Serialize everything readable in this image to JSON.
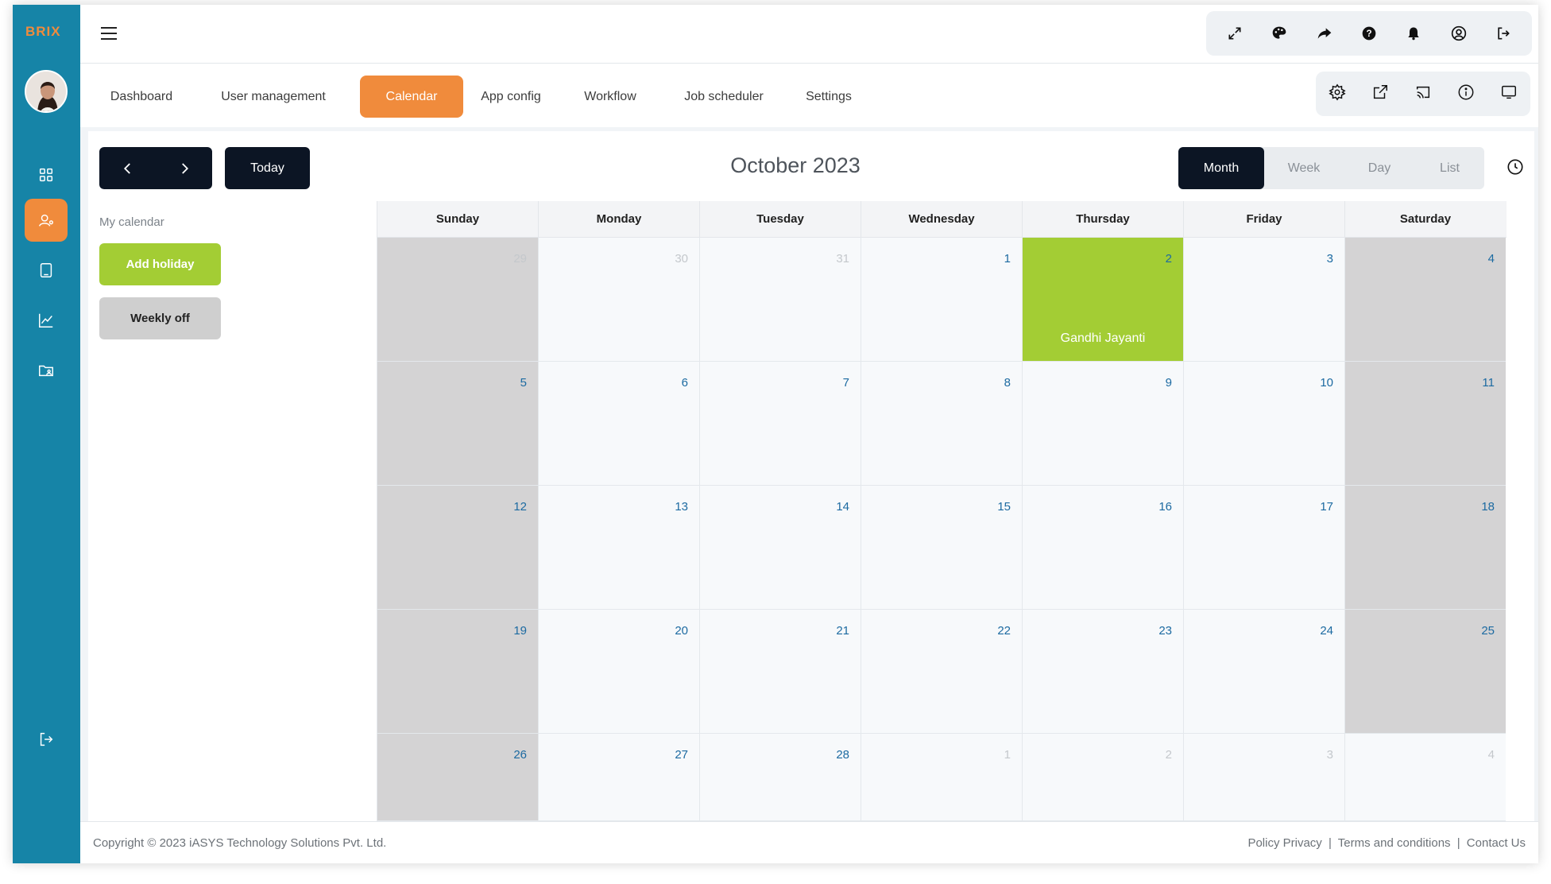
{
  "brand": {
    "logo_text": "BRIX",
    "accent": "#f08b3c",
    "sidebar_color": "#1684a7"
  },
  "sidebar": {
    "items": [
      {
        "name": "dashboard",
        "icon": "grid-icon"
      },
      {
        "name": "user-management",
        "icon": "user-cog-icon",
        "active": true
      },
      {
        "name": "documents",
        "icon": "tablet-icon"
      },
      {
        "name": "analytics",
        "icon": "chart-icon"
      },
      {
        "name": "folder",
        "icon": "folder-user-icon"
      }
    ],
    "logout_icon": "logout-icon"
  },
  "topbar": {
    "icons": [
      "expand-icon",
      "palette-icon",
      "share-icon",
      "help-icon",
      "bell-icon",
      "account-icon",
      "logout-icon"
    ]
  },
  "tabs": [
    {
      "label": "Dashboard"
    },
    {
      "label": "User management"
    },
    {
      "label": "Calendar",
      "active": true
    },
    {
      "label": "App config"
    },
    {
      "label": "Workflow"
    },
    {
      "label": "Job scheduler"
    },
    {
      "label": "Settings"
    }
  ],
  "tab_icons": [
    "settings-icon",
    "external-link-icon",
    "cast-icon",
    "info-icon",
    "monitor-icon"
  ],
  "calendar": {
    "today_label": "Today",
    "title": "October 2023",
    "views": [
      "Month",
      "Week",
      "Day",
      "List"
    ],
    "active_view": "Month",
    "side_title": "My calendar",
    "add_holiday_label": "Add holiday",
    "weekly_off_label": "Weekly off",
    "day_headers": [
      "Sunday",
      "Monday",
      "Tuesday",
      "Wednesday",
      "Thursday",
      "Friday",
      "Saturday"
    ],
    "weeks": [
      [
        "29",
        "30",
        "31",
        "1",
        "2",
        "3",
        "4"
      ],
      [
        "5",
        "6",
        "7",
        "8",
        "9",
        "10",
        "11"
      ],
      [
        "12",
        "13",
        "14",
        "15",
        "16",
        "17",
        "18"
      ],
      [
        "19",
        "20",
        "21",
        "22",
        "23",
        "24",
        "25"
      ],
      [
        "26",
        "27",
        "28",
        "1",
        "2",
        "3",
        "4"
      ]
    ],
    "holiday": {
      "week": 0,
      "day": 4,
      "name": "Gandhi Jayanti",
      "color": "#a3cd34"
    }
  },
  "footer": {
    "copyright": "Copyright © 2023  iASYS Technology Solutions Pvt. Ltd.",
    "policy": "Policy Privacy",
    "terms": "Terms and conditions",
    "contact": "Contact Us",
    "separator": "|"
  }
}
